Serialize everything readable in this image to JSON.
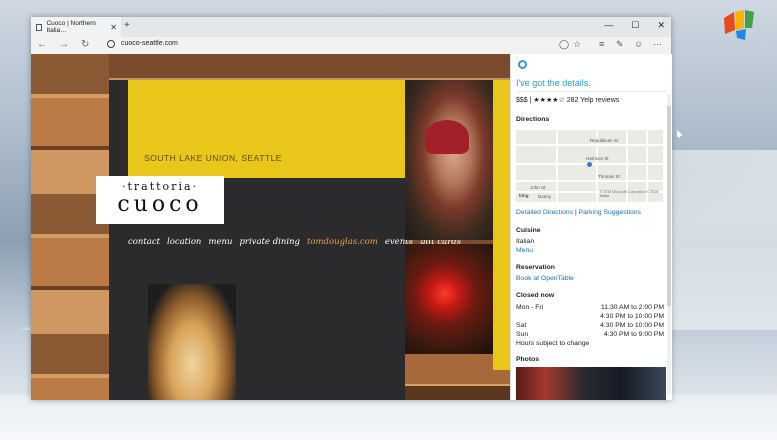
{
  "browser": {
    "tab_title": "Cuoco | Northern Italia…",
    "tab_close": "✕",
    "new_tab": "+",
    "url": "cuoco-seattle.com",
    "window_controls": {
      "minimize": "—",
      "maximize": "☐",
      "close": "✕"
    },
    "nav": {
      "back": "←",
      "forward": "→",
      "refresh": "↻"
    },
    "toolbar": {
      "reading": "◯",
      "favorite": "☆",
      "hub": "≡",
      "note": "✎",
      "cortana": "☺",
      "more": "⋯"
    }
  },
  "site": {
    "address": "SOUTH LAKE UNION, SEATTLE",
    "brand_top": "·trattoria·",
    "brand_name": "cuoco",
    "nav": [
      "contact",
      "location",
      "menu",
      "private dining",
      "tomdouglas.com",
      "events",
      "gift cards"
    ]
  },
  "cortana": {
    "title": "I've got the details.",
    "rating": "$$$ | ★★★★☆ 282 Yelp reviews",
    "directions_heading": "Directions",
    "map_labels": {
      "republican": "Republican St",
      "harrison": "Harrison St",
      "thomas": "Thomas St",
      "john": "John St",
      "denny": "Denny",
      "terry": "Terry Ave N",
      "boren": "Boren Ave N",
      "fairview": "Fairview Ave N",
      "eastlake": "Eastlake Ave E",
      "dexter": "Dexter Ave N",
      "ninth": "9th Ave N",
      "copyright": "© 2015 Microsoft Corporation  © 2015 Nokia",
      "bing": "bing"
    },
    "links": {
      "detailed_directions": "Detailed Directions",
      "separator": "|",
      "parking": "Parking Suggestions"
    },
    "cuisine_heading": "Cuisine",
    "cuisine": "Italian",
    "menu_link": "Menu",
    "reservation_heading": "Reservation",
    "reservation_link": "Book at OpenTable",
    "status": "Closed now",
    "hours": [
      {
        "day": "Mon - Fri",
        "time": "11:30 AM to 2:00 PM"
      },
      {
        "day": "",
        "time": "4:30 PM to 10:00 PM"
      },
      {
        "day": "Sat",
        "time": "4:30 PM to 10:00 PM"
      },
      {
        "day": "Sun",
        "time": "4:30 PM to 9:00 PM"
      }
    ],
    "hours_note": "Hours subject to change",
    "photos_heading": "Photos"
  }
}
